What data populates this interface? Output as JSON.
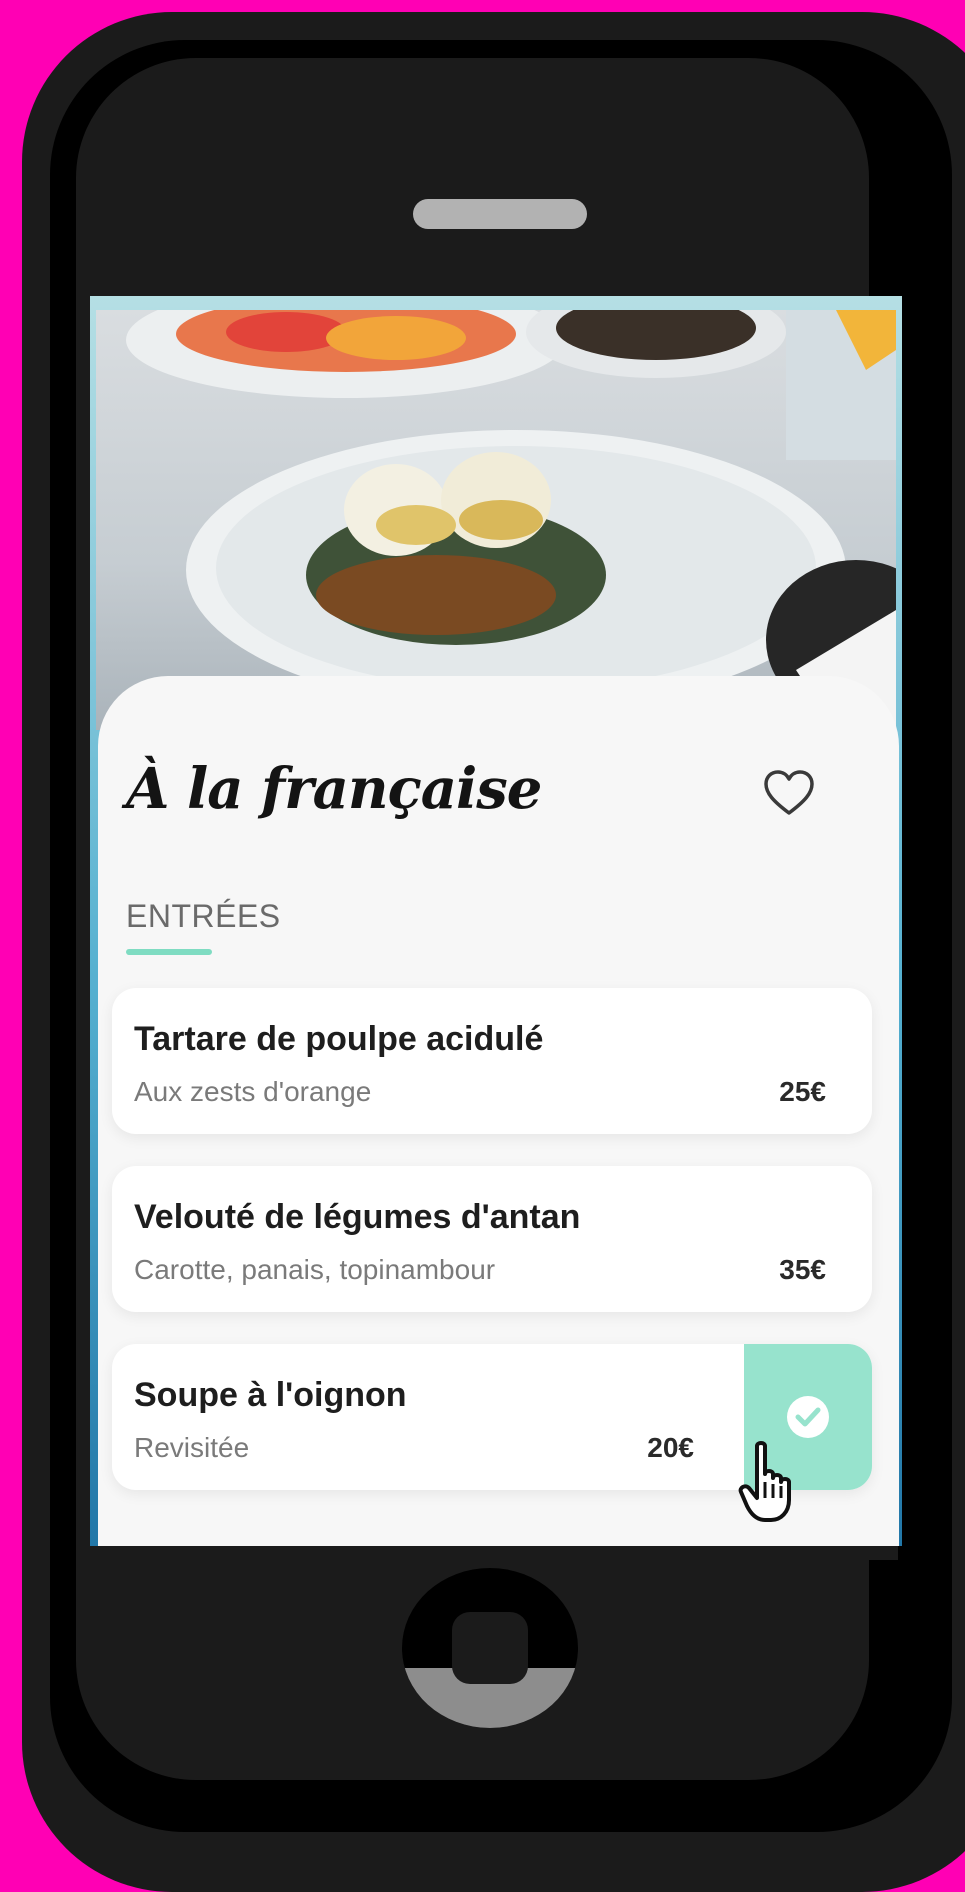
{
  "restaurant": {
    "title": "À la française"
  },
  "menu": {
    "section_label": "ENTRÉES",
    "items": [
      {
        "name": "Tartare de poulpe acidulé",
        "description": "Aux zests d'orange",
        "price": "25€",
        "selected": false
      },
      {
        "name": "Velouté de légumes d'antan",
        "description": "Carotte, panais, topinambour",
        "price": "35€",
        "selected": false
      },
      {
        "name": "Soupe à l'oignon",
        "description": "Revisitée",
        "price": "20€",
        "selected": true
      }
    ]
  },
  "icons": {
    "favorite": "heart-icon",
    "selected": "check-circle-icon",
    "cursor": "hand-pointer-icon"
  },
  "colors": {
    "accent": "#97e3cd",
    "underline": "#7fdcc2",
    "background": "#ff00b4",
    "sheet": "#f7f7f7",
    "title": "#141414"
  }
}
